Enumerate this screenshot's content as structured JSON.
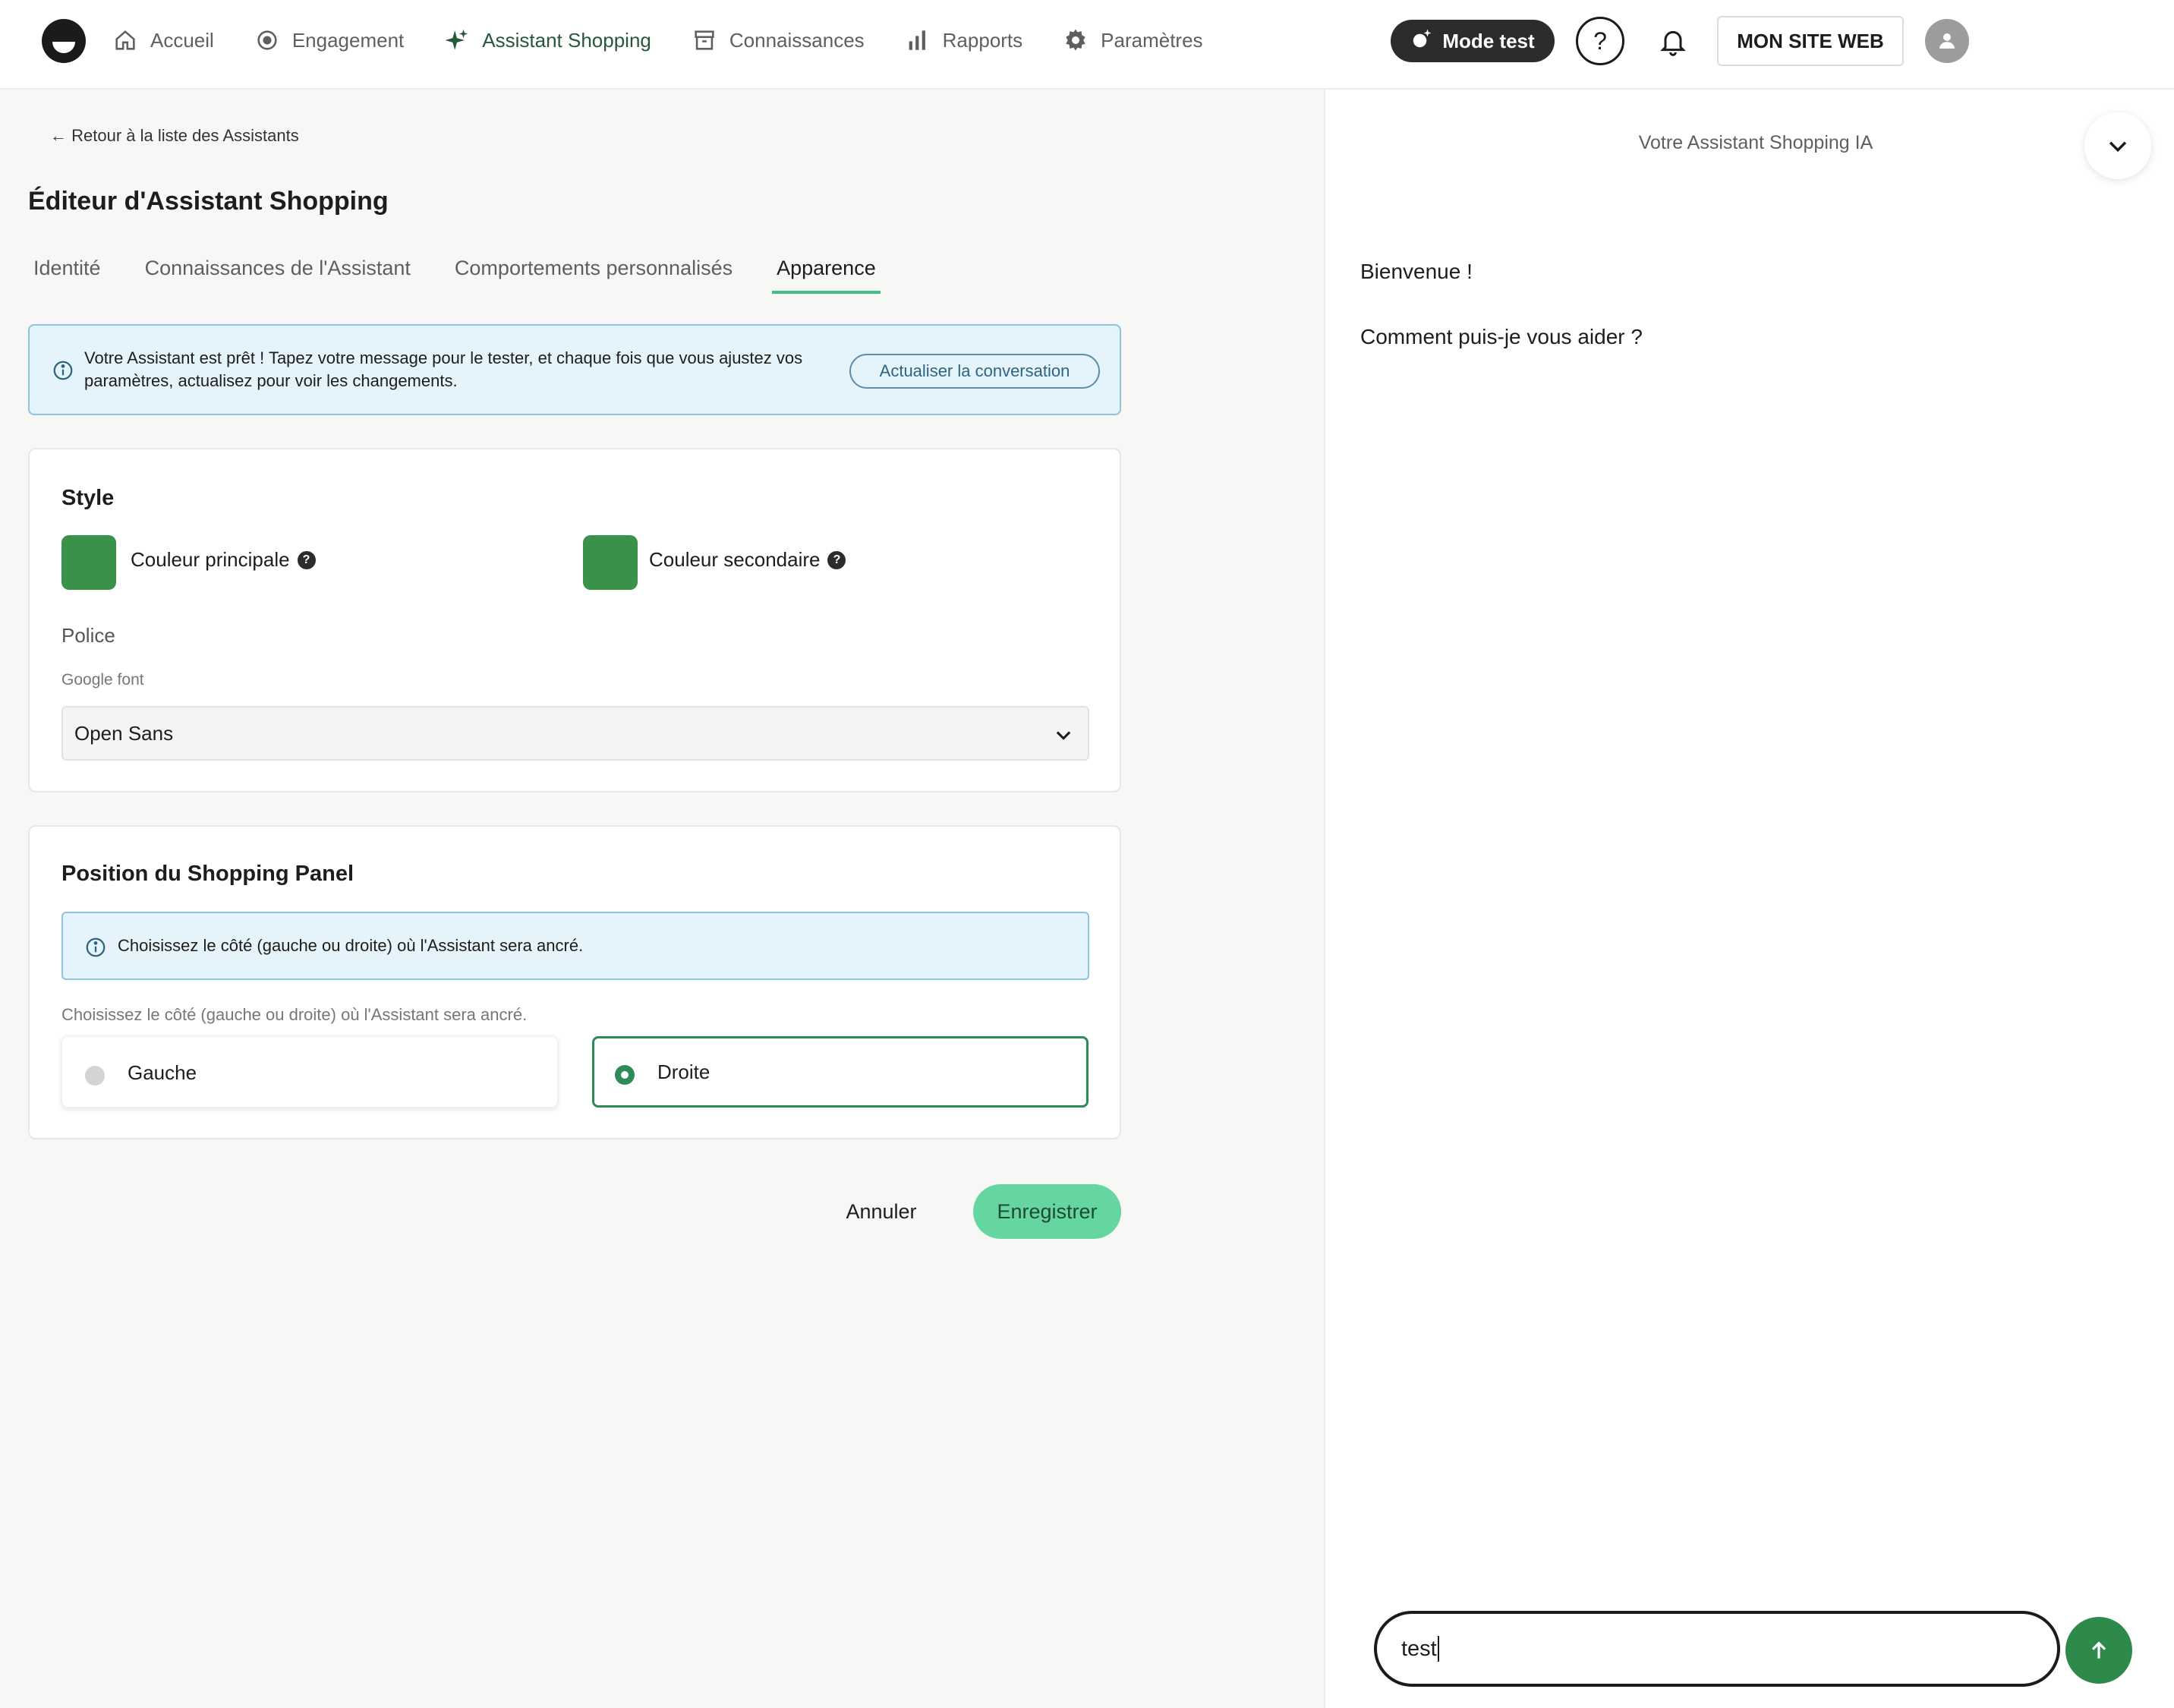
{
  "nav": {
    "items": [
      {
        "label": "Accueil",
        "icon": "home-icon"
      },
      {
        "label": "Engagement",
        "icon": "target-icon"
      },
      {
        "label": "Assistant Shopping",
        "icon": "sparkle-icon",
        "active": true
      },
      {
        "label": "Connaissances",
        "icon": "archive-icon"
      },
      {
        "label": "Rapports",
        "icon": "bar-chart-icon"
      },
      {
        "label": "Paramètres",
        "icon": "gear-icon"
      }
    ],
    "mode_test_label": "Mode test",
    "help_label": "?",
    "site_label": "MON SITE WEB"
  },
  "editor": {
    "back_label": "← Retour à la liste des Assistants",
    "title": "Éditeur d'Assistant Shopping",
    "tabs": [
      {
        "label": "Identité"
      },
      {
        "label": "Connaissances de l'Assistant"
      },
      {
        "label": "Comportements personnalisés"
      },
      {
        "label": "Apparence",
        "active": true
      }
    ],
    "alert": {
      "text": "Votre Assistant est prêt ! Tapez votre message pour le tester, et chaque fois que vous ajustez vos paramètres, actualisez pour voir les changements.",
      "button_label": "Actualiser la conversation"
    },
    "style": {
      "title": "Style",
      "primary_color_label": "Couleur principale",
      "primary_color": "#39914a",
      "secondary_color_label": "Couleur secondaire",
      "secondary_color": "#39914a",
      "police_label": "Police",
      "font_field_label": "Google font",
      "font_value": "Open Sans"
    },
    "position": {
      "title": "Position du Shopping Panel",
      "alert_text": "Choisissez le côté (gauche ou droite) où l'Assistant sera ancré.",
      "help_text": "Choisissez le côté (gauche ou droite) où l'Assistant sera ancré.",
      "options": [
        {
          "label": "Gauche",
          "selected": false
        },
        {
          "label": "Droite",
          "selected": true
        }
      ]
    },
    "cancel_label": "Annuler",
    "save_label": "Enregistrer"
  },
  "chat": {
    "title": "Votre Assistant Shopping IA",
    "messages": [
      "Bienvenue !",
      "Comment puis-je vous aider ?"
    ],
    "input_value": "test"
  },
  "colors": {
    "accent": "#3fbf86",
    "save_button": "#66d6a0",
    "send_button": "#2e8a4a",
    "info_bg": "#e5f4fa"
  }
}
